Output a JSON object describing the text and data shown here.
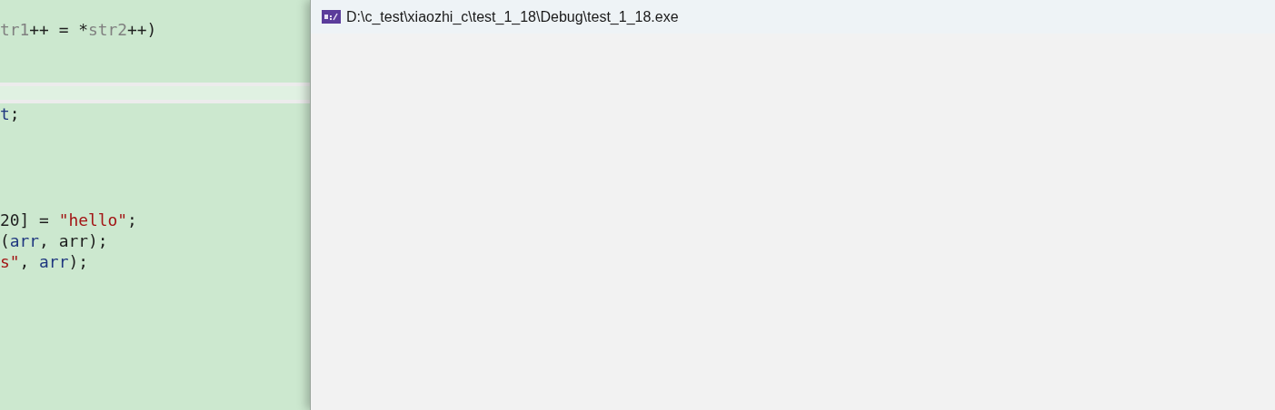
{
  "editor": {
    "lines": [
      {
        "current": false,
        "tokens": [
          {
            "kind": "var",
            "text": "tr1"
          },
          {
            "kind": "plain",
            "text": "++ = *"
          },
          {
            "kind": "var",
            "text": "str2"
          },
          {
            "kind": "plain",
            "text": "++)"
          }
        ]
      },
      {
        "current": false
      },
      {
        "current": false
      },
      {
        "current": true
      },
      {
        "current": false,
        "tokens": [
          {
            "kind": "param",
            "text": "t"
          },
          {
            "kind": "plain",
            "text": ";"
          }
        ]
      },
      {
        "current": false
      },
      {
        "current": false
      },
      {
        "current": false
      },
      {
        "current": false
      },
      {
        "current": false,
        "tokens": [
          {
            "kind": "plain",
            "text": "20] = "
          },
          {
            "kind": "string",
            "text": "\"hello\""
          },
          {
            "kind": "plain",
            "text": ";"
          }
        ]
      },
      {
        "current": false,
        "tokens": [
          {
            "kind": "plain",
            "text": "("
          },
          {
            "kind": "param",
            "text": "arr"
          },
          {
            "kind": "plain",
            "text": ", arr);"
          }
        ]
      },
      {
        "current": false,
        "tokens": [
          {
            "kind": "string",
            "text": "s\""
          },
          {
            "kind": "plain",
            "text": ", "
          },
          {
            "kind": "param",
            "text": "arr"
          },
          {
            "kind": "plain",
            "text": ");"
          }
        ]
      }
    ]
  },
  "console": {
    "title": "D:\\c_test\\xiaozhi_c\\test_1_18\\Debug\\test_1_18.exe"
  }
}
